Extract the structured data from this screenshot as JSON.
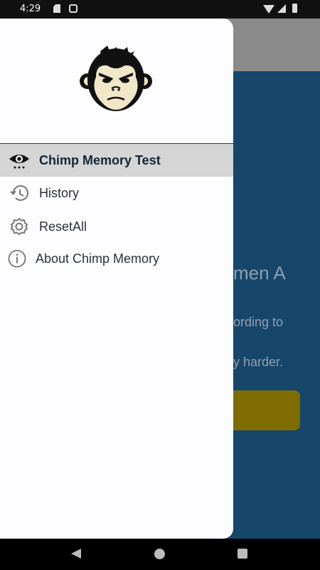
{
  "status_bar": {
    "time": "4:29"
  },
  "background": {
    "title": "men A",
    "line1": "ording to",
    "line2": "y harder."
  },
  "drawer": {
    "logo_icon": "chimp-face-icon",
    "items": [
      {
        "label": "Chimp Memory Test",
        "icon": "eye-icon",
        "active": true
      },
      {
        "label": "History",
        "icon": "history-icon",
        "active": false
      },
      {
        "label": "ResetAll",
        "icon": "gear-icon",
        "active": false
      },
      {
        "label": "About Chimp Memory",
        "icon": "info-icon",
        "active": false
      }
    ]
  },
  "colors": {
    "background_app": "#17466b",
    "appbar": "#8a8a8a",
    "accent_button": "#7f6c00",
    "active_item": "#d5d5d5"
  }
}
